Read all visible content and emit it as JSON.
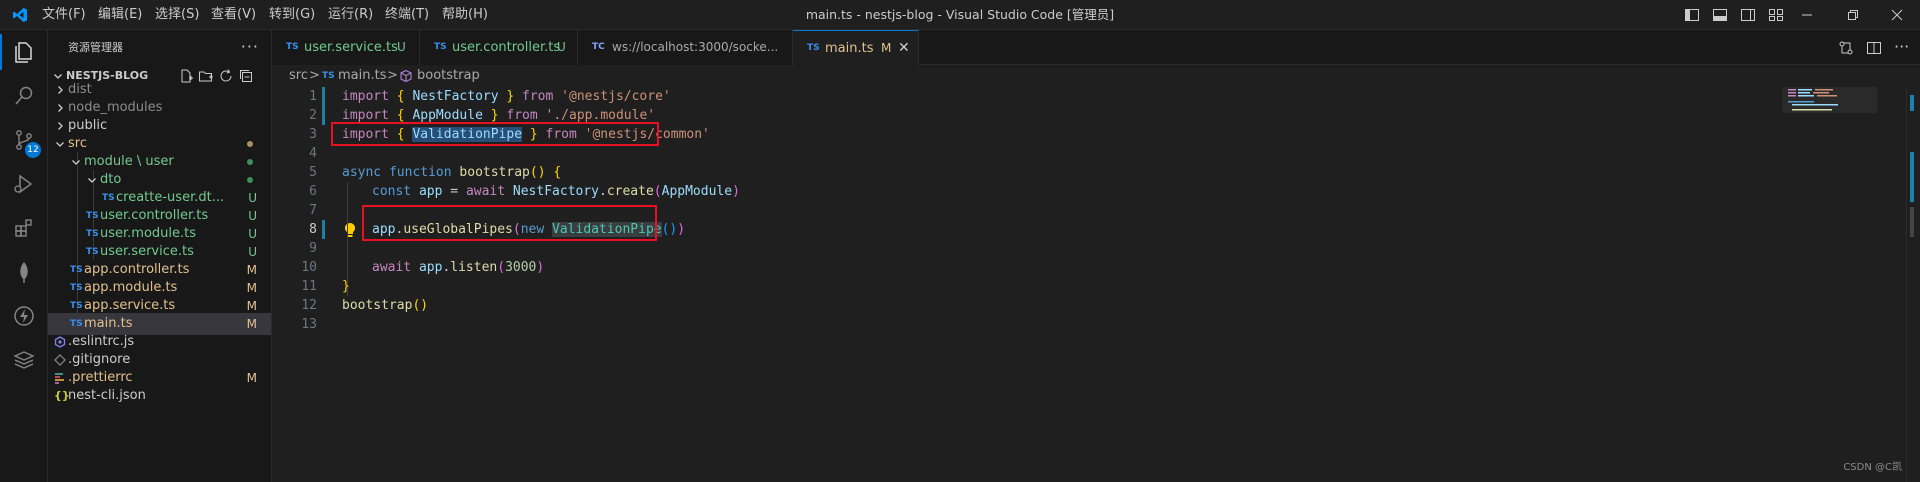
{
  "titlebar": {
    "menu": [
      "文件(F)",
      "编辑(E)",
      "选择(S)",
      "查看(V)",
      "转到(G)",
      "运行(R)",
      "终端(T)",
      "帮助(H)"
    ],
    "window_title": "main.ts - nestjs-blog - Visual Studio Code [管理员]"
  },
  "activitybar": {
    "scm_badge": "12"
  },
  "sidebar": {
    "title": "资源管理器",
    "more": "···",
    "project": "NESTJS-BLOG",
    "tree": [
      {
        "label": "dist",
        "status": ""
      },
      {
        "label": "node_modules",
        "status": ""
      },
      {
        "label": "public",
        "status": ""
      },
      {
        "label": "src",
        "status": ""
      },
      {
        "label": "module \\ user",
        "status": ""
      },
      {
        "label": "dto",
        "status": ""
      },
      {
        "label": "creatte-user.dt...",
        "status": "U"
      },
      {
        "label": "user.controller.ts",
        "status": "U"
      },
      {
        "label": "user.module.ts",
        "status": "U"
      },
      {
        "label": "user.service.ts",
        "status": "U"
      },
      {
        "label": "app.controller.ts",
        "status": "M"
      },
      {
        "label": "app.module.ts",
        "status": "M"
      },
      {
        "label": "app.service.ts",
        "status": "M"
      },
      {
        "label": "main.ts",
        "status": "M"
      },
      {
        "label": ".eslintrc.js",
        "status": ""
      },
      {
        "label": ".gitignore",
        "status": ""
      },
      {
        "label": ".prettierrc",
        "status": "M"
      },
      {
        "label": "nest-cli.json",
        "status": ""
      }
    ],
    "ts_badge": "TS",
    "json_badge": "{}"
  },
  "tabs": [
    {
      "type": "TS",
      "label": "user.service.ts",
      "status": "U"
    },
    {
      "type": "TS",
      "label": "user.controller.ts",
      "status": "U"
    },
    {
      "type": "TC",
      "label": "ws://localhost:3000/socke...",
      "status": ""
    },
    {
      "type": "TS",
      "label": "main.ts",
      "status": "M",
      "close": "✕"
    }
  ],
  "breadcrumb": {
    "folder": "src",
    "sep": ">",
    "file_badge": "TS",
    "file": "main.ts",
    "symbol": "bootstrap"
  },
  "editor": {
    "line_numbers": [
      "1",
      "2",
      "3",
      "4",
      "5",
      "6",
      "7",
      "8",
      "9",
      "10",
      "11",
      "12",
      "13"
    ],
    "lines": {
      "l1": {
        "t1": "import",
        "t2": " { ",
        "t3": "NestFactory",
        "t4": " } ",
        "t5": "from",
        "t6": " '@nestjs/core'"
      },
      "l2": {
        "t1": "import",
        "t2": " { ",
        "t3": "AppModule",
        "t4": " } ",
        "t5": "from",
        "t6": " './app.module'"
      },
      "l3": {
        "t1": "import",
        "t2": " { ",
        "t3": "ValidationPipe",
        "t4": " } ",
        "t5": "from",
        "t6": " '@nestjs/common'"
      },
      "l5": {
        "t1": "async",
        "t2": " function ",
        "t3": "bootstrap",
        "t4": "() {"
      },
      "l6": {
        "t1": "const",
        "t2": " app",
        "t3": " = ",
        "t4": "await",
        "t5": " NestFactory",
        "t6": ".",
        "t7": "create",
        "t8": "(",
        "t9": "AppModule",
        "t10": ")"
      },
      "l8": {
        "t1": "app",
        "t2": ".",
        "t3": "useGlobalPipes",
        "t4": "(",
        "t5": "new",
        "t6": " ",
        "t7": "ValidationPipe",
        "t8": "()",
        "t9": ")"
      },
      "l10": {
        "t1": "await",
        "t2": " app",
        "t3": ".",
        "t4": "listen",
        "t5": "(",
        "t6": "3000",
        "t7": ")"
      },
      "l11": {
        "t1": "}"
      },
      "l12": {
        "t1": "bootstrap",
        "t2": "()"
      }
    }
  },
  "watermark": "CSDN @C凯"
}
